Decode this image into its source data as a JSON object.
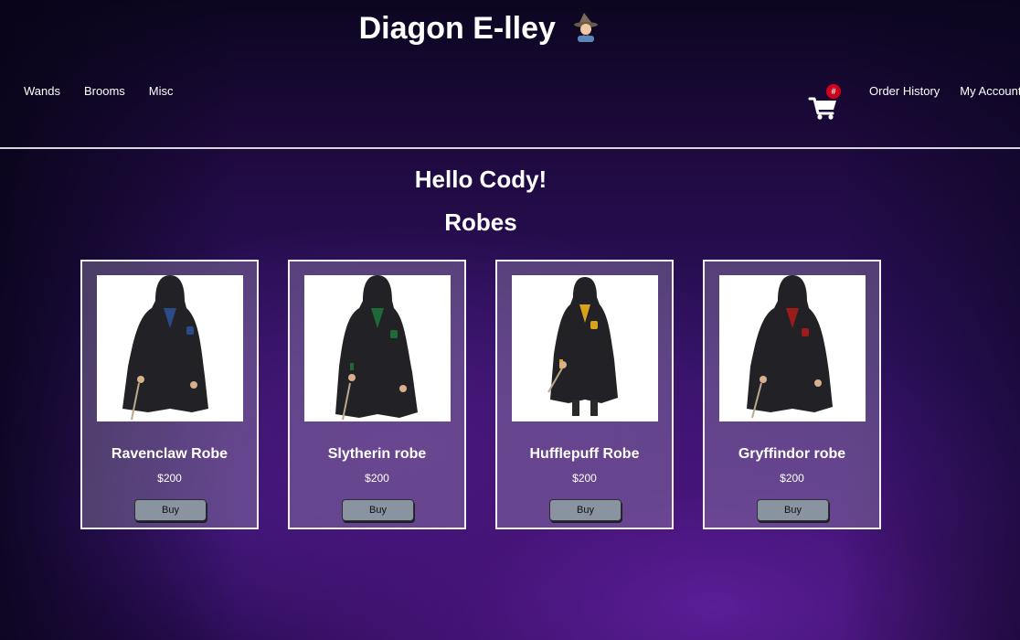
{
  "site": {
    "title": "Diagon E-lley"
  },
  "nav": {
    "left": [
      "Wands",
      "Brooms",
      "Misc"
    ],
    "right": [
      "Order History",
      "My Account"
    ]
  },
  "cart": {
    "badge": "#"
  },
  "greeting": "Hello Cody!",
  "category": "Robes",
  "products": [
    {
      "name": "Ravenclaw Robe",
      "price": "$200",
      "buy_label": "Buy",
      "accent": "#2b4a8a"
    },
    {
      "name": "Slytherin robe",
      "price": "$200",
      "buy_label": "Buy",
      "accent": "#1e6b3a"
    },
    {
      "name": "Hufflepuff Robe",
      "price": "$200",
      "buy_label": "Buy",
      "accent": "#d9a21b"
    },
    {
      "name": "Gryffindor robe",
      "price": "$200",
      "buy_label": "Buy",
      "accent": "#9c1c1c"
    }
  ],
  "colors": {
    "divider": "#d8d4e0",
    "badge": "#d0021b",
    "button": "#8a93a0"
  }
}
